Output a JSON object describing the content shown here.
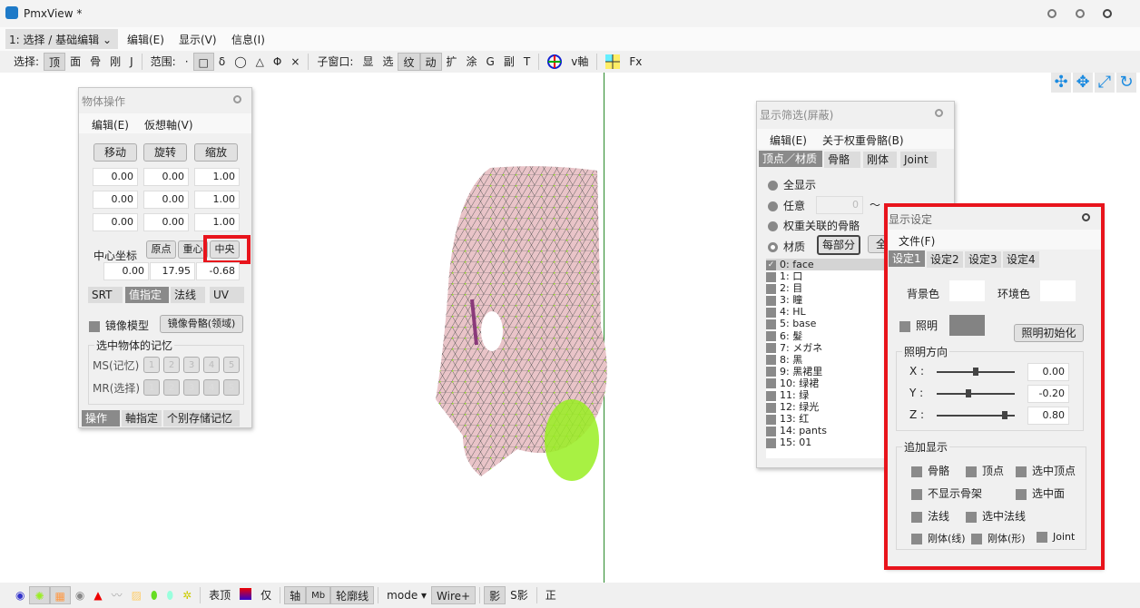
{
  "window": {
    "title": "PmxView *",
    "controls": [
      "minimize",
      "maximize",
      "close"
    ]
  },
  "menubar": {
    "mode": "1: 选择 / 基础编辑",
    "items": [
      "编辑(E)",
      "显示(V)",
      "信息(I)"
    ]
  },
  "toolbar": {
    "select_label": "选择:",
    "select_items": [
      "顶",
      "面",
      "骨",
      "刚",
      "J"
    ],
    "range_label": "范围:",
    "range_items": [
      "·",
      "□",
      "δ",
      "◯",
      "△",
      "Φ",
      "×"
    ],
    "subwin_label": "子窗口:",
    "subwin_items": [
      "显",
      "选",
      "纹",
      "动",
      "扩",
      "涂",
      "G",
      "副",
      "T"
    ],
    "vaxis": "v軸",
    "fx": "Fx"
  },
  "view_controls": [
    "rotate-icon",
    "move-icon",
    "zoom-icon",
    "reset-rotation-icon"
  ],
  "object_panel": {
    "title": "物体操作",
    "menu": [
      "编辑(E)",
      "仮想軸(V)"
    ],
    "buttons": [
      "移动",
      "旋转",
      "缩放"
    ],
    "rows": [
      [
        "0.00",
        "0.00",
        "1.00"
      ],
      [
        "0.00",
        "0.00",
        "1.00"
      ],
      [
        "0.00",
        "0.00",
        "1.00"
      ]
    ],
    "center_label": "中心坐标",
    "center_buttons": [
      "原点",
      "重心",
      "中央"
    ],
    "center_values": [
      "0.00",
      "17.95",
      "-0.68"
    ],
    "tabs": [
      "SRT",
      "值指定",
      "法线",
      "UV"
    ],
    "mirror_model": "镜像模型",
    "mirror_bone": "镜像骨骼(领域)",
    "memory_group": "选中物体的记忆",
    "ms_label": "MS(记忆)",
    "mr_label": "MR(选择)",
    "slots": [
      "1",
      "2",
      "3",
      "4",
      "5"
    ],
    "bottom_tabs": [
      "操作",
      "軸指定",
      "个别存储记忆"
    ]
  },
  "filter_panel": {
    "title": "显示筛选(屏蔽)",
    "menu": [
      "编辑(E)",
      "关于权重骨骼(B)"
    ],
    "tabs": [
      "顶点／材质",
      "骨骼",
      "刚体",
      "Joint"
    ],
    "options": [
      "全显示",
      "任意",
      "权重关联的骨骼",
      "材质"
    ],
    "range_from": "0",
    "range_tilde": "〜",
    "per_part": "每部分",
    "all_btn": "全",
    "materials": [
      "0: face",
      "1: 口",
      "2: 目",
      "3: 瞳",
      "4: HL",
      "5: base",
      "6: 髮",
      "7: メガネ",
      "8: 黑",
      "9: 黑裙里",
      "10: 绿裙",
      "11: 绿",
      "12: 绿光",
      "13: 红",
      "14: pants",
      "15: 01"
    ]
  },
  "display_panel": {
    "title": "显示设定",
    "menu": [
      "文件(F)"
    ],
    "tabs": [
      "设定1",
      "设定2",
      "设定3",
      "设定4"
    ],
    "bg_label": "背景色",
    "env_label": "环境色",
    "light_label": "照明",
    "light_reset": "照明初始化",
    "light_dir_group": "照明方向",
    "axes": [
      {
        "label": "X :",
        "value": "0.00",
        "level": 0.5
      },
      {
        "label": "Y :",
        "value": "-0.20",
        "level": 0.4
      },
      {
        "label": "Z :",
        "value": "0.80",
        "level": 0.9
      }
    ],
    "extra_group": "追加显示",
    "extras": [
      "骨骼",
      "顶点",
      "选中顶点",
      "不显示骨架",
      "选中面",
      "法线",
      "选中法线",
      "刚体(线)",
      "刚体(形)",
      "Joint"
    ]
  },
  "bottombar": {
    "items": [
      "表顶",
      "仅",
      "轴",
      "Mb",
      "轮廓线",
      "mode",
      "Wire+",
      "影",
      "S影",
      "正"
    ]
  },
  "colors": {
    "highlight": "#e8141c",
    "mesh": "#e8c0c4",
    "vertex": "#99ee22",
    "axis": "#2a8a2a"
  }
}
